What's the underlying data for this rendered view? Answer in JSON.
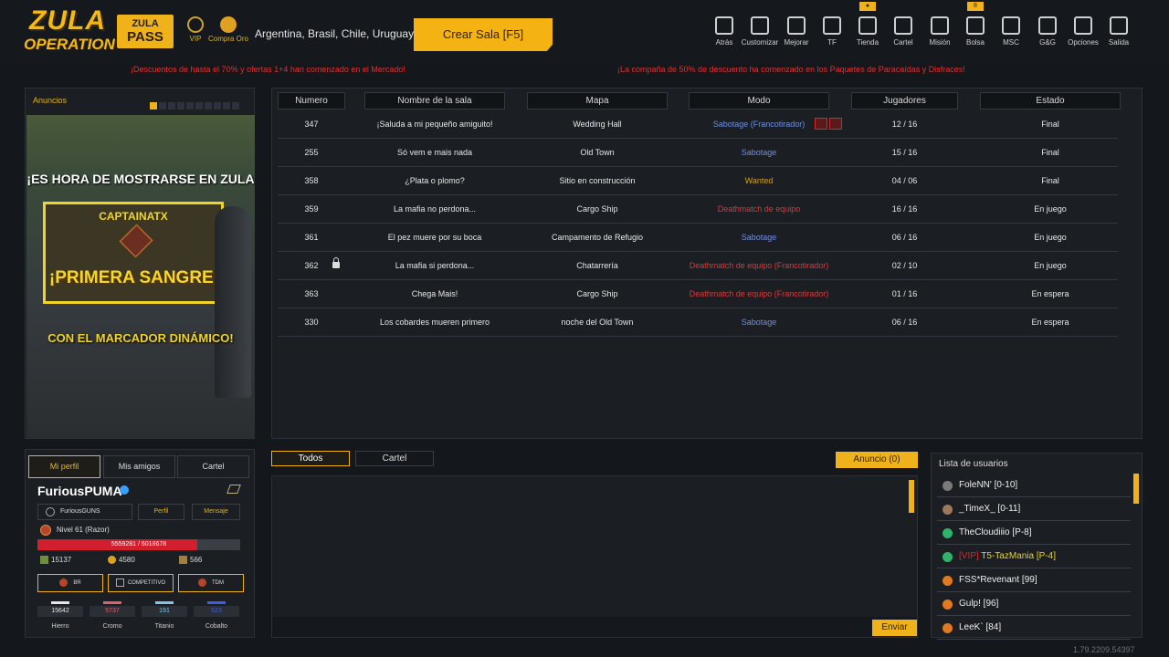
{
  "logo": {
    "line1": "ZULA",
    "line2": "OPERATION"
  },
  "zula_pass": {
    "line1": "ZULA",
    "line2": "PASS"
  },
  "top_mini": [
    {
      "label": "VIP",
      "icon": "laurel-icon"
    },
    {
      "label": "Compra Oro",
      "icon": "gold-coin-icon"
    }
  ],
  "region": "Argentina, Brasil, Chile, Uruguay 1",
  "create_room": "Crear Sala [F5]",
  "nav": [
    {
      "label": "Atrás",
      "icon": "exit-icon"
    },
    {
      "label": "Customizar",
      "icon": "tools-icon"
    },
    {
      "label": "Mejorar",
      "icon": "upgrade-icon"
    },
    {
      "label": "TF",
      "icon": "tf-icon"
    },
    {
      "label": "Tienda",
      "icon": "cart-icon",
      "badge": "●"
    },
    {
      "label": "Cartel",
      "icon": "group-icon"
    },
    {
      "label": "Misión",
      "icon": "mission-icon"
    },
    {
      "label": "Bolsa",
      "icon": "bag-icon",
      "badge": "8"
    },
    {
      "label": "MSC",
      "icon": "msc-icon"
    },
    {
      "label": "G&G",
      "icon": "wallet-icon"
    },
    {
      "label": "Opciones",
      "icon": "gear-icon"
    },
    {
      "label": "Salida",
      "icon": "power-icon"
    }
  ],
  "promos": [
    "¡Descuentos de hasta el 70% y ofertas 1+4 han comenzado en el Mercado!",
    "¡La compaña de 50% de descuento ha comenzado en los Paquetes de Paracaídas y Disfraces!"
  ],
  "announcements": {
    "title": "Anuncios",
    "banner_top": "¡ES HORA DE MOSTRARSE EN ZULA",
    "banner_name": "CAPTAINATX",
    "banner_main": "¡PRIMERA SANGRE!",
    "banner_bottom": "CON EL MARCADOR DINÁMICO!"
  },
  "rooms": {
    "headers": [
      "Numero",
      "Nombre de la sala",
      "Mapa",
      "Modo",
      "Jugadores",
      "Estado"
    ],
    "rows": [
      {
        "num": "347",
        "name": "¡Saluda a mi pequeño amiguito!",
        "map": "Wedding Hall",
        "mode": "Sabotage (Francotirador)",
        "mode_color": "#6f8fe0",
        "players": "12 / 16",
        "state": "Final",
        "icons": true
      },
      {
        "num": "255",
        "name": "Só vem e mais nada",
        "map": "Old Town",
        "mode": "Sabotage",
        "mode_color": "#6f8fe0",
        "players": "15 / 16",
        "state": "Final"
      },
      {
        "num": "358",
        "name": "¿Plata o plomo?",
        "map": "Sitio en construcción",
        "mode": "Wanted",
        "mode_color": "#d4a017",
        "players": "04 / 06",
        "state": "Final"
      },
      {
        "num": "359",
        "name": "La mafia no perdona...",
        "map": "Cargo Ship",
        "mode": "Deathmatch de equipo",
        "mode_color": "#d83a3a",
        "players": "16 / 16",
        "state": "En juego"
      },
      {
        "num": "361",
        "name": "El pez muere por su boca",
        "map": "Campamento de Refugio",
        "mode": "Sabotage",
        "mode_color": "#6f8fe0",
        "players": "06 / 16",
        "state": "En juego"
      },
      {
        "num": "362",
        "name": "La mafia si perdona...",
        "map": "Chatarrería",
        "mode": "Deathmatch de equipo (Francotirador)",
        "mode_color": "#d83a3a",
        "players": "02 / 10",
        "state": "En juego",
        "locked": true
      },
      {
        "num": "363",
        "name": "Chega Mais!",
        "map": "Cargo Ship",
        "mode": "Deathmatch de equipo (Francotirador)",
        "mode_color": "#d83a3a",
        "players": "01 / 16",
        "state": "En espera"
      },
      {
        "num": "330",
        "name": "Los cobardes mueren primero",
        "map": "noche del Old Town",
        "mode": "Sabotage",
        "mode_color": "#6f8fe0",
        "players": "06 / 16",
        "state": "En espera"
      }
    ]
  },
  "profile": {
    "tabs": [
      "Mi perfil",
      "Mis amigos",
      "Cartel"
    ],
    "username": "FuriousPUMA",
    "clan": "FuriousGUNS",
    "btn_profile": "Perfil",
    "btn_message": "Mensaje",
    "level": "Nivel 61 (Razor)",
    "xp_text": "5559281 / 6018678",
    "xp_progress": 0.79,
    "currencies": [
      {
        "value": "15137",
        "color": "#6f8f3a"
      },
      {
        "value": "4580",
        "color": "#d9a520"
      },
      {
        "value": "566",
        "color": "#a08040"
      }
    ],
    "ranks": [
      "BR",
      "COMPETITIVO",
      "TDM"
    ],
    "stats": [
      {
        "value": "15642",
        "label": "Hierro",
        "color": "#e6e6e6"
      },
      {
        "value": "5737",
        "label": "Cromo",
        "color": "#e0606a"
      },
      {
        "value": "191",
        "label": "Titanio",
        "color": "#7fc6e0"
      },
      {
        "value": "523",
        "label": "Cobalto",
        "color": "#3f5fe0"
      }
    ]
  },
  "chat": {
    "tabs": [
      "Todos",
      "Cartel"
    ],
    "announcement": "Anuncio (0)",
    "send": "Enviar"
  },
  "users": {
    "title": "Lista de usuarios",
    "list": [
      {
        "name": "FoleNN' [0-10]",
        "icon_color": "#7a7a7a"
      },
      {
        "name": "_TimeX_ [0-11]",
        "icon_color": "#9a7a5a"
      },
      {
        "name": "TheCloudiiio [P-8]",
        "icon_color": "#2fb36a"
      },
      {
        "vip": "[VIP]",
        "name": "T5-TazMania [P-4]",
        "icon_color": "#2fb36a"
      },
      {
        "name": "FSS*Revenant [99]",
        "icon_color": "#e07a20"
      },
      {
        "name": "Gulp! [96]",
        "icon_color": "#e07a20"
      },
      {
        "name": "LeeK` [84]",
        "icon_color": "#e07a20"
      }
    ]
  },
  "version": "1.79.2209.54397"
}
